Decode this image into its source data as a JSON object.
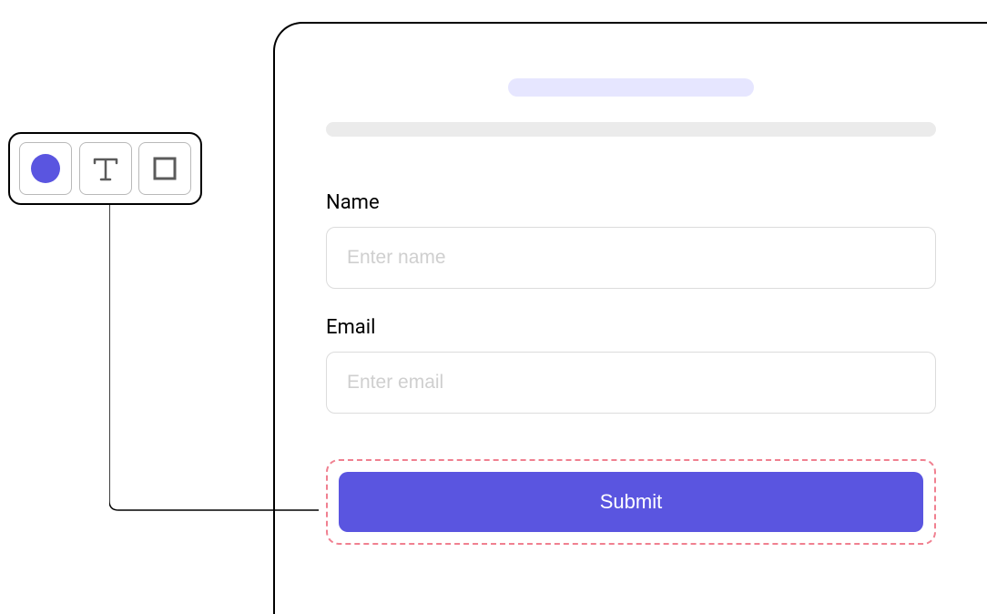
{
  "form": {
    "name": {
      "label": "Name",
      "placeholder": "Enter name"
    },
    "email": {
      "label": "Email",
      "placeholder": "Enter email"
    },
    "submit_label": "Submit"
  },
  "toolbar": {
    "tools": [
      "color",
      "text",
      "rectangle"
    ]
  },
  "colors": {
    "accent": "#5a55e0",
    "selection": "#f08090"
  }
}
